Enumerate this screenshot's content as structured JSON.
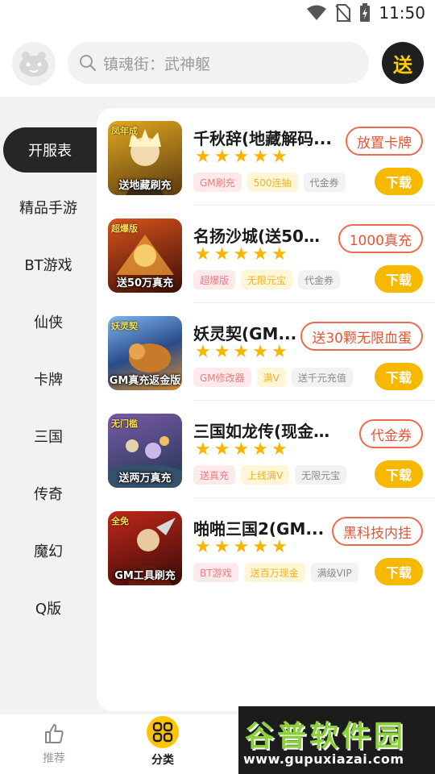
{
  "status_bar": {
    "time": "11:50"
  },
  "header": {
    "search_placeholder": "镇魂街：武神躯",
    "gift_label": "送"
  },
  "sidebar": {
    "items": [
      {
        "label": "开服表",
        "active": true
      },
      {
        "label": "精品手游"
      },
      {
        "label": "BT游戏"
      },
      {
        "label": "仙侠"
      },
      {
        "label": "卡牌"
      },
      {
        "label": "三国"
      },
      {
        "label": "传奇"
      },
      {
        "label": "魔幻"
      },
      {
        "label": "Q版"
      }
    ]
  },
  "games": [
    {
      "title": "千秋辞(地藏解码...",
      "promo": "放置卡牌",
      "thumb_caption": "送地藏刷充",
      "thumb_badge": "凤年成",
      "tags": [
        {
          "text": "GM刷充",
          "style": "pink"
        },
        {
          "text": "500连抽",
          "style": "yellow"
        },
        {
          "text": "代金券",
          "style": "gray"
        }
      ],
      "download": "下载",
      "thumb_colors": [
        "#5a3a10",
        "#e0a820"
      ]
    },
    {
      "title": "名扬沙城(送50万...",
      "promo": "1000真充",
      "thumb_caption": "送50万真充",
      "thumb_badge": "超爆版",
      "tags": [
        {
          "text": "超爆版",
          "style": "pink"
        },
        {
          "text": "无限元宝",
          "style": "yellow"
        },
        {
          "text": "代金券",
          "style": "gray"
        }
      ],
      "download": "下载",
      "thumb_colors": [
        "#3a0e06",
        "#d9531c"
      ]
    },
    {
      "title": "妖灵契(GM...",
      "promo": "送30颗无限血蛋",
      "thumb_caption": "GM真充返金版",
      "thumb_badge": "妖灵契",
      "tags": [
        {
          "text": "GM修改器",
          "style": "pink"
        },
        {
          "text": "满V",
          "style": "yellow"
        },
        {
          "text": "送千元充值",
          "style": "gray"
        }
      ],
      "download": "下载",
      "thumb_colors": [
        "#2a4c8a",
        "#d98a2a"
      ]
    },
    {
      "title": "三国如龙传(现金点...",
      "promo": "代金券",
      "thumb_caption": "送两万真充",
      "thumb_badge": "无门槛",
      "tags": [
        {
          "text": "送真充",
          "style": "pink"
        },
        {
          "text": "上线满V",
          "style": "yellow"
        },
        {
          "text": "无限元宝",
          "style": "gray"
        }
      ],
      "download": "下载",
      "thumb_colors": [
        "#1f3550",
        "#7a5aa8"
      ]
    },
    {
      "title": "啪啪三国2(GM...",
      "promo": "黑科技内挂",
      "thumb_caption": "GM工具刷充",
      "thumb_badge": "全免",
      "tags": [
        {
          "text": "BT游戏",
          "style": "pink"
        },
        {
          "text": "送百万现金",
          "style": "yellow"
        },
        {
          "text": "满级VIP",
          "style": "gray"
        }
      ],
      "download": "下载",
      "thumb_colors": [
        "#3a0a08",
        "#c0281a"
      ]
    }
  ],
  "bottom_nav": {
    "items": [
      {
        "label": "推荐",
        "icon": "thumbs-up-icon"
      },
      {
        "label": "分类",
        "icon": "grid-icon",
        "active": true
      }
    ]
  },
  "watermark": {
    "title": "谷普软件园",
    "url": "www.gupuxiazai.com"
  },
  "colors": {
    "accent_yellow": "#f6b800",
    "promo_red": "#e55535",
    "active_sidebar": "#262626"
  }
}
